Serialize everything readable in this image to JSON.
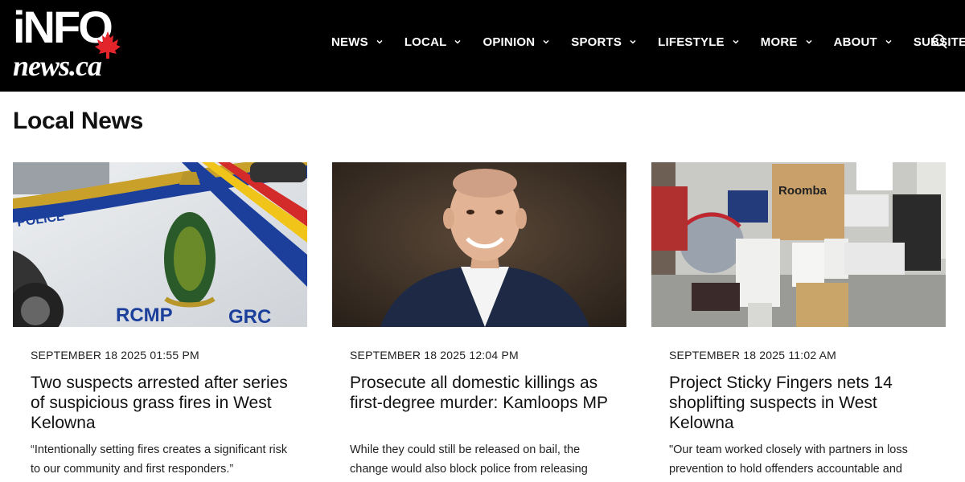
{
  "header": {
    "logo": {
      "line1": "iNFO",
      "line2": "news.ca"
    },
    "nav": [
      {
        "label": "NEWS"
      },
      {
        "label": "LOCAL"
      },
      {
        "label": "OPINION"
      },
      {
        "label": "SPORTS"
      },
      {
        "label": "LIFESTYLE"
      },
      {
        "label": "MORE"
      },
      {
        "label": "ABOUT"
      },
      {
        "label": "SUBSITES"
      }
    ],
    "search_icon": "search-icon",
    "maple_color": "#e3242b"
  },
  "main": {
    "title": "Local News",
    "articles": [
      {
        "image_alt": "RCMP police car door",
        "date": "SEPTEMBER 18 2025 01:55 PM",
        "title": "Two suspects arrested after series of suspicious grass fires in West Kelowna",
        "excerpt": "“Intentionally setting fires creates a significant risk to our community and first responders.”",
        "image_text_left": "POLICE",
        "image_text_bottom_left": "RCMP",
        "image_text_bottom_right": "GRC"
      },
      {
        "image_alt": "Smiling man in suit",
        "date": "SEPTEMBER 18 2025 12:04 PM",
        "title": "Prosecute all domestic killings as first-degree murder: Kamloops MP",
        "excerpt": "While they could still be released on bail, the change would also block police from releasing"
      },
      {
        "image_alt": "Pile of recovered stolen goods",
        "date": "SEPTEMBER 18 2025 11:02 AM",
        "title": "Project Sticky Fingers nets 14 shoplifting suspects in West Kelowna",
        "excerpt": "\"Our team worked closely with partners in loss prevention to hold offenders accountable and",
        "image_box_label": "Roomba"
      }
    ]
  }
}
